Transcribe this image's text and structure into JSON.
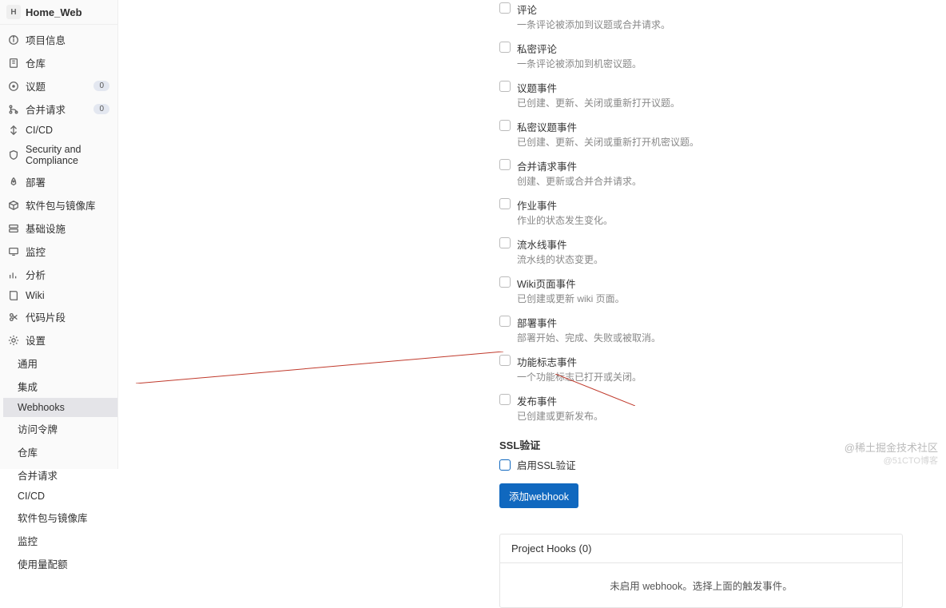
{
  "project": {
    "avatar": "H",
    "name": "Home_Web"
  },
  "nav": [
    {
      "icon": "info",
      "label": "项目信息"
    },
    {
      "icon": "repo",
      "label": "仓库"
    },
    {
      "icon": "issue",
      "label": "议题",
      "badge": "0"
    },
    {
      "icon": "merge",
      "label": "合并请求",
      "badge": "0"
    },
    {
      "icon": "pipeline",
      "label": "CI/CD"
    },
    {
      "icon": "shield",
      "label": "Security and Compliance"
    },
    {
      "icon": "rocket",
      "label": "部署"
    },
    {
      "icon": "package",
      "label": "软件包与镜像库"
    },
    {
      "icon": "infra",
      "label": "基础设施"
    },
    {
      "icon": "monitor",
      "label": "监控"
    },
    {
      "icon": "chart",
      "label": "分析"
    },
    {
      "icon": "book",
      "label": "Wiki"
    },
    {
      "icon": "scissors",
      "label": "代码片段"
    },
    {
      "icon": "gear",
      "label": "设置"
    }
  ],
  "settings_sub": [
    {
      "label": "通用",
      "active": false
    },
    {
      "label": "集成",
      "active": false
    },
    {
      "label": "Webhooks",
      "active": true
    },
    {
      "label": "访问令牌",
      "active": false
    },
    {
      "label": "仓库",
      "active": false
    },
    {
      "label": "合并请求",
      "active": false
    },
    {
      "label": "CI/CD",
      "active": false
    },
    {
      "label": "软件包与镜像库",
      "active": false
    },
    {
      "label": "监控",
      "active": false
    },
    {
      "label": "使用量配额",
      "active": false
    }
  ],
  "triggers": [
    {
      "label": "评论",
      "desc": "一条评论被添加到议题或合并请求。"
    },
    {
      "label": "私密评论",
      "desc": "一条评论被添加到机密议题。"
    },
    {
      "label": "议题事件",
      "desc": "已创建、更新、关闭或重新打开议题。"
    },
    {
      "label": "私密议题事件",
      "desc": "已创建、更新、关闭或重新打开机密议题。"
    },
    {
      "label": "合并请求事件",
      "desc": "创建、更新或合并合并请求。"
    },
    {
      "label": "作业事件",
      "desc": "作业的状态发生变化。"
    },
    {
      "label": "流水线事件",
      "desc": "流水线的状态变更。"
    },
    {
      "label": "Wiki页面事件",
      "desc": "已创建或更新 wiki 页面。"
    },
    {
      "label": "部署事件",
      "desc": "部署开始、完成、失败或被取消。"
    },
    {
      "label": "功能标志事件",
      "desc": "一个功能标志已打开或关闭。"
    },
    {
      "label": "发布事件",
      "desc": "已创建或更新发布。"
    }
  ],
  "ssl": {
    "title": "SSL验证",
    "label": "启用SSL验证"
  },
  "add_button": "添加webhook",
  "hooks": {
    "header": "Project Hooks (0)",
    "empty": "未启用 webhook。选择上面的触发事件。"
  },
  "watermarks": {
    "line1": "@稀土掘金技术社区",
    "line2": "@51CTO博客"
  }
}
